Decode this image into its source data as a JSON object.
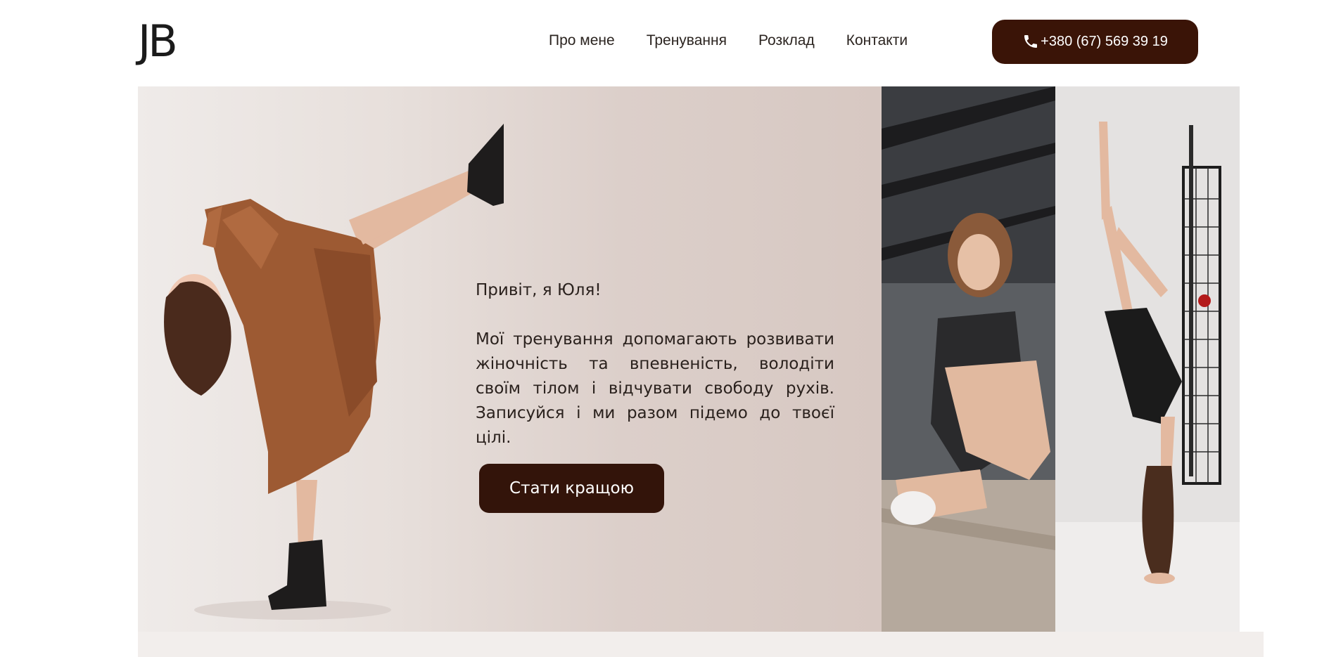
{
  "header": {
    "logo": "JB",
    "nav": [
      {
        "label": "Про мене"
      },
      {
        "label": "Тренування"
      },
      {
        "label": "Розклад"
      },
      {
        "label": "Контакти"
      }
    ],
    "phone": "+380 (67) 569 39 19",
    "phone_icon": "phone-icon"
  },
  "hero": {
    "greeting": "Привіт, я Юля!",
    "intro": "Мої тренування допомагають розвивати жіночність та впевненість, володіти своїм тілом і відчувати свободу рухів. Записуйся і ми разом підемо до твоєї цілі.",
    "cta": "Стати кращою"
  },
  "colors": {
    "accent": "#3a1407",
    "hero_bg": "#e5dbd6",
    "band": "#f2eeec"
  }
}
